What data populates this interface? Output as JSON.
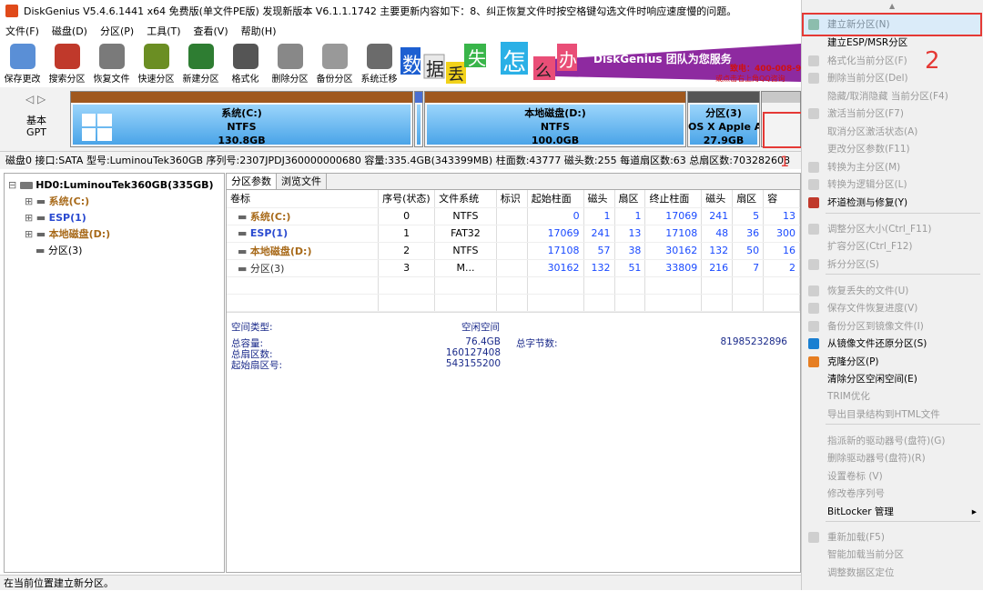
{
  "title": "DiskGenius V5.4.6.1441 x64 免费版(单文件PE版)   发现新版本 V6.1.1.1742   主要更新内容如下：8、纠正恢复文件时按空格键勾选文件时响应速度慢的问题。",
  "menu": [
    "文件(F)",
    "磁盘(D)",
    "分区(P)",
    "工具(T)",
    "查看(V)",
    "帮助(H)"
  ],
  "toolbar": [
    {
      "label": "保存更改",
      "color": "#5a8fd6"
    },
    {
      "label": "搜索分区",
      "color": "#c0392b"
    },
    {
      "label": "恢复文件",
      "color": "#7a7a7a"
    },
    {
      "label": "快速分区",
      "color": "#6b8e23"
    },
    {
      "label": "新建分区",
      "color": "#2e7d32"
    },
    {
      "label": "格式化",
      "color": "#555555"
    },
    {
      "label": "删除分区",
      "color": "#888888"
    },
    {
      "label": "备份分区",
      "color": "#999999"
    },
    {
      "label": "系统迁移",
      "color": "#6b6b6b"
    }
  ],
  "banner": {
    "chars": [
      "数",
      "据",
      "丢",
      "失",
      "怎",
      "么",
      "办"
    ],
    "slogan": "DiskGenius 团队为您服务",
    "phone": "致电：400-008-9958",
    "qq": "或点击右上角QQ咨询"
  },
  "disk_type": {
    "line1": "基本",
    "line2": "GPT"
  },
  "partitions": [
    {
      "name": "系统(C:)",
      "fs": "NTFS",
      "size": "130.8GB"
    },
    {
      "name": "本地磁盘(D:)",
      "fs": "NTFS",
      "size": "100.0GB"
    },
    {
      "name": "分区(3)",
      "fs": "OS X Apple A",
      "size": "27.9GB"
    }
  ],
  "disk_info": "磁盘0 接口:SATA  型号:LuminouTek360GB  序列号:2307JPDJ360000000680  容量:335.4GB(343399MB)  柱面数:43777  磁头数:255  每道扇区数:63  总扇区数:703282608",
  "tree": {
    "root": "HD0:LuminouTek360GB(335GB)",
    "items": [
      "系统(C:)",
      "ESP(1)",
      "本地磁盘(D:)",
      "分区(3)"
    ]
  },
  "tabs": [
    "分区参数",
    "浏览文件"
  ],
  "table": {
    "headers": [
      "卷标",
      "序号(状态)",
      "文件系统",
      "标识",
      "起始柱面",
      "磁头",
      "扇区",
      "终止柱面",
      "磁头",
      "扇区",
      "容"
    ],
    "rows": [
      [
        "系统(C:)",
        "0",
        "NTFS",
        "",
        "0",
        "1",
        "1",
        "17069",
        "241",
        "5",
        "13"
      ],
      [
        "ESP(1)",
        "1",
        "FAT32",
        "",
        "17069",
        "241",
        "13",
        "17108",
        "48",
        "36",
        "300"
      ],
      [
        "本地磁盘(D:)",
        "2",
        "NTFS",
        "",
        "17108",
        "57",
        "38",
        "30162",
        "132",
        "50",
        "16"
      ],
      [
        "分区(3)",
        "3",
        "M...",
        "",
        "30162",
        "132",
        "51",
        "33809",
        "216",
        "7",
        "2"
      ]
    ]
  },
  "info": {
    "space_type_label": "空间类型:",
    "space_type_value": "空闲空间",
    "total_cap_label": "总容量:",
    "total_cap_value": "76.4GB",
    "total_bytes_label": "总字节数:",
    "total_bytes_value": "81985232896",
    "total_sectors_label": "总扇区数:",
    "total_sectors_value": "160127408",
    "start_sector_label": "起始扇区号:",
    "start_sector_value": "543155200"
  },
  "status": "在当前位置建立新分区。",
  "annotations": {
    "one": "1",
    "two": "2"
  },
  "context_menu": [
    {
      "label": "建立新分区(N)",
      "enabled": true,
      "icon": "layers-icon"
    },
    {
      "label": "建立ESP/MSR分区",
      "enabled": true,
      "icon": ""
    },
    {
      "label": "格式化当前分区(F)",
      "enabled": false,
      "icon": "format-icon"
    },
    {
      "label": "删除当前分区(Del)",
      "enabled": false,
      "icon": "delete-icon"
    },
    {
      "label": "隐藏/取消隐藏 当前分区(F4)",
      "enabled": false,
      "icon": ""
    },
    {
      "label": "激活当前分区(F7)",
      "enabled": false,
      "icon": "star-icon"
    },
    {
      "label": "取消分区激活状态(A)",
      "enabled": false,
      "icon": ""
    },
    {
      "label": "更改分区参数(F11)",
      "enabled": false,
      "icon": ""
    },
    {
      "label": "转换为主分区(M)",
      "enabled": false,
      "icon": "convert-icon"
    },
    {
      "label": "转换为逻辑分区(L)",
      "enabled": false,
      "icon": "convert-icon"
    },
    {
      "label": "坏道检测与修复(Y)",
      "enabled": true,
      "icon": "tools-icon"
    },
    {
      "label": "调整分区大小(Ctrl_F11)",
      "enabled": false,
      "icon": "resize-icon"
    },
    {
      "label": "扩容分区(Ctrl_F12)",
      "enabled": false,
      "icon": ""
    },
    {
      "label": "拆分分区(S)",
      "enabled": false,
      "icon": "split-icon"
    },
    {
      "label": "恢复丢失的文件(U)",
      "enabled": false,
      "icon": "recover-icon"
    },
    {
      "label": "保存文件恢复进度(V)",
      "enabled": false,
      "icon": "save-icon"
    },
    {
      "label": "备份分区到镜像文件(I)",
      "enabled": false,
      "icon": "backup-icon"
    },
    {
      "label": "从镜像文件还原分区(S)",
      "enabled": true,
      "icon": "restore-icon"
    },
    {
      "label": "克隆分区(P)",
      "enabled": true,
      "icon": "clone-icon"
    },
    {
      "label": "清除分区空闲空间(E)",
      "enabled": true,
      "icon": ""
    },
    {
      "label": "TRIM优化",
      "enabled": false,
      "icon": ""
    },
    {
      "label": "导出目录结构到HTML文件",
      "enabled": false,
      "icon": ""
    },
    {
      "label": "指派新的驱动器号(盘符)(G)",
      "enabled": false,
      "icon": ""
    },
    {
      "label": "删除驱动器号(盘符)(R)",
      "enabled": false,
      "icon": ""
    },
    {
      "label": "设置卷标 (V)",
      "enabled": false,
      "icon": ""
    },
    {
      "label": "修改卷序列号",
      "enabled": false,
      "icon": ""
    },
    {
      "label": "BitLocker 管理",
      "enabled": true,
      "icon": ""
    },
    {
      "label": "重新加载(F5)",
      "enabled": false,
      "icon": "reload-icon"
    },
    {
      "label": "智能加载当前分区",
      "enabled": false,
      "icon": ""
    },
    {
      "label": "调整数据区定位",
      "enabled": false,
      "icon": ""
    }
  ],
  "colors": {
    "highlight_border": "#e53935",
    "annotation": "#e53935",
    "blue_text": "#1a4aff"
  }
}
